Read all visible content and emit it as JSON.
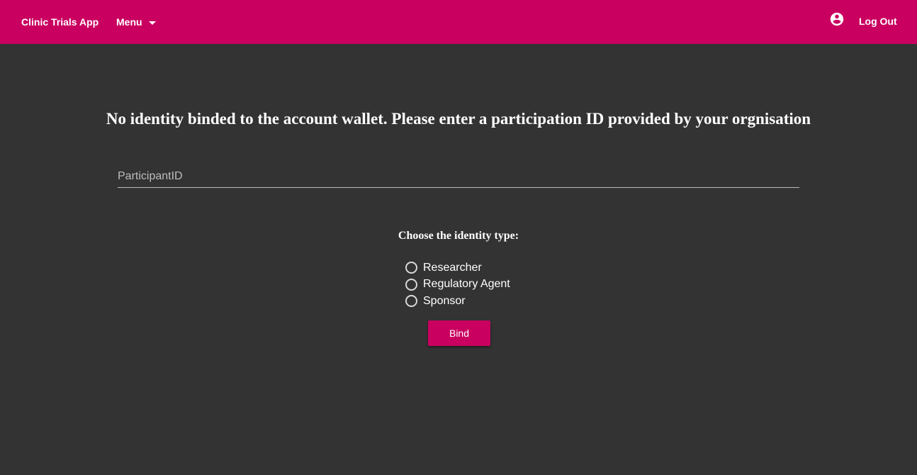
{
  "appbar": {
    "title": "Clinic Trials App",
    "menu_label": "Menu",
    "account_icon": "account-circle-icon",
    "logout_label": "Log Out",
    "color": "#c90060"
  },
  "main": {
    "heading": "No identity binded to the account wallet. Please enter a participation ID provided by your orgnisation",
    "participant_field": {
      "placeholder": "ParticipantID",
      "value": ""
    },
    "identity_label": "Choose the identity type:",
    "identity_options": [
      {
        "label": "Researcher",
        "selected": false
      },
      {
        "label": "Regulatory Agent",
        "selected": false
      },
      {
        "label": "Sponsor",
        "selected": false
      }
    ],
    "bind_label": "Bind"
  },
  "colors": {
    "background": "#333333",
    "accent": "#c90060"
  }
}
